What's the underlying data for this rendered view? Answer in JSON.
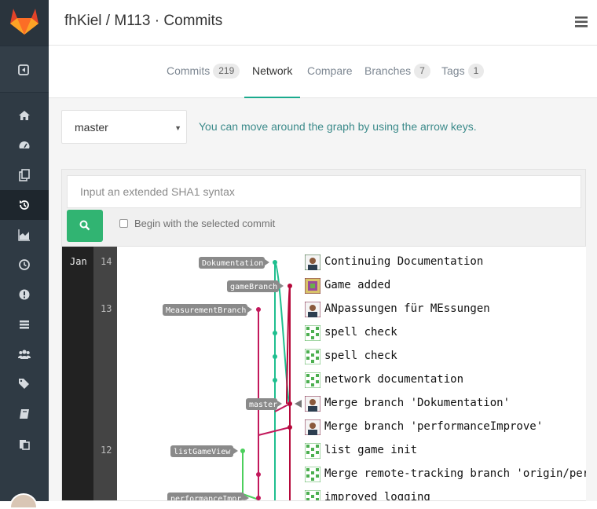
{
  "header": {
    "title": "fhKiel / M113 · Commits"
  },
  "tabs": [
    {
      "label": "Commits",
      "count": "219"
    },
    {
      "label": "Network"
    },
    {
      "label": "Compare"
    },
    {
      "label": "Branches",
      "count": "7"
    },
    {
      "label": "Tags",
      "count": "1"
    }
  ],
  "branch_selector": {
    "value": "master"
  },
  "help_text": "You can move around the graph by using the arrow keys.",
  "sha_search": {
    "placeholder": "Input an extended SHA1 syntax",
    "checkbox_label": "Begin with the selected commit"
  },
  "graph": {
    "month": "Jan",
    "days": [
      "14",
      "13",
      "12"
    ],
    "refs": [
      "Dokumentation",
      "gameBranch",
      "MeasurementBranch",
      "master",
      "listGameView",
      "performanceImpr…"
    ],
    "commits": [
      {
        "message": "Continuing Documentation"
      },
      {
        "message": "Game added"
      },
      {
        "message": "ANpassungen für MEssungen"
      },
      {
        "message": "spell check"
      },
      {
        "message": "spell check"
      },
      {
        "message": "network documentation"
      },
      {
        "message": "Merge branch 'Dokumentation'"
      },
      {
        "message": "Merge branch 'performanceImprove'"
      },
      {
        "message": "list game init"
      },
      {
        "message": "Merge remote-tracking branch 'origin/performanceImprove'"
      },
      {
        "message": "improved logging"
      }
    ]
  },
  "colors": {
    "accent": "#1aaa8d",
    "sidebar": "#2f3a44",
    "search_button": "#31b472",
    "branch_teal": "#1fbf8f",
    "branch_red": "#b5083a",
    "branch_magenta": "#c2185b",
    "branch_green": "#4ccf5c"
  }
}
